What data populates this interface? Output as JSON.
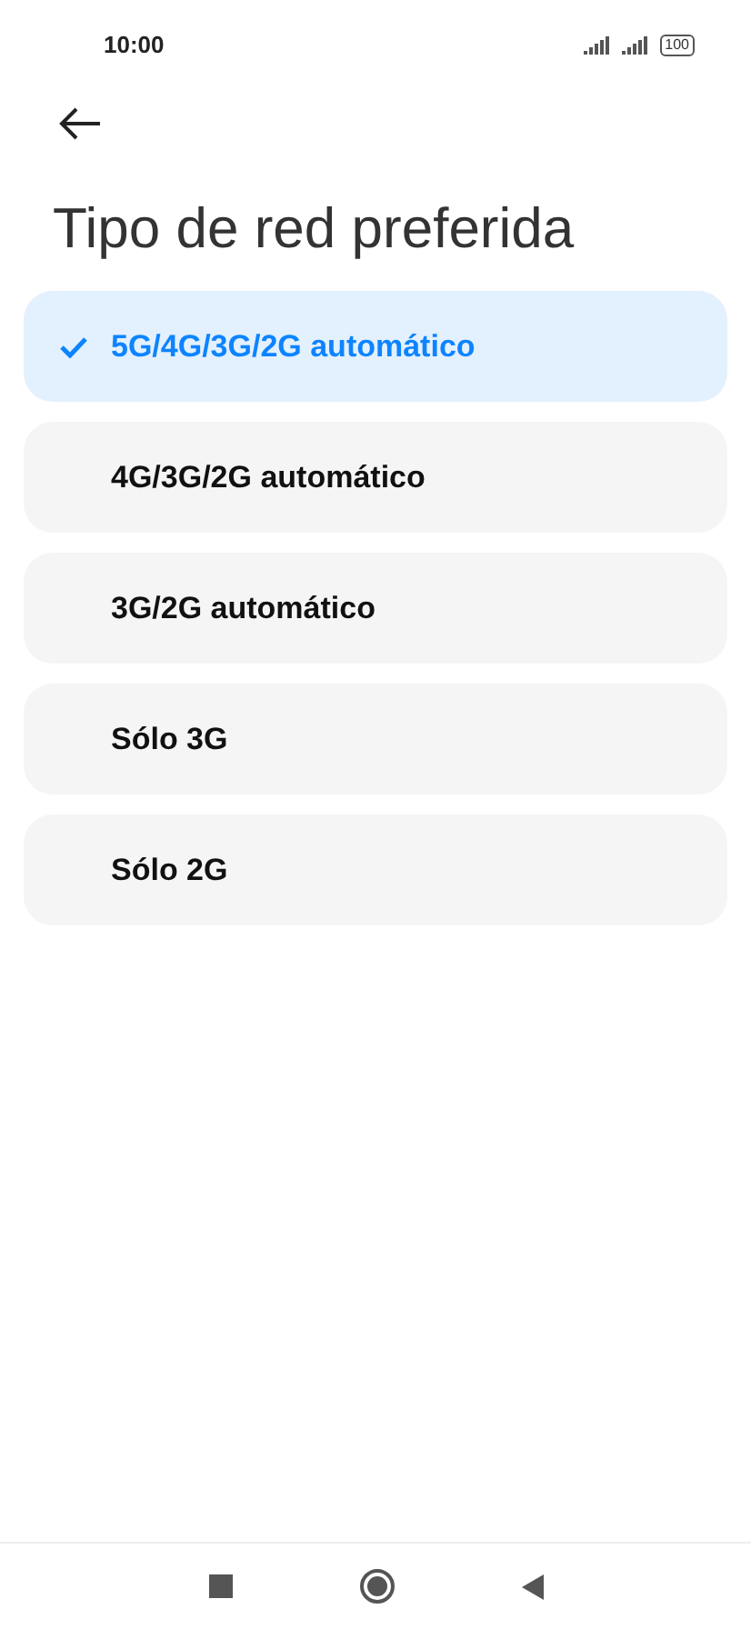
{
  "status_bar": {
    "time": "10:00",
    "battery": "100"
  },
  "title": "Tipo de red preferida",
  "options": [
    {
      "label": "5G/4G/3G/2G automático",
      "selected": true
    },
    {
      "label": "4G/3G/2G automático",
      "selected": false
    },
    {
      "label": "3G/2G automático",
      "selected": false
    },
    {
      "label": "Sólo 3G",
      "selected": false
    },
    {
      "label": "Sólo 2G",
      "selected": false
    }
  ]
}
